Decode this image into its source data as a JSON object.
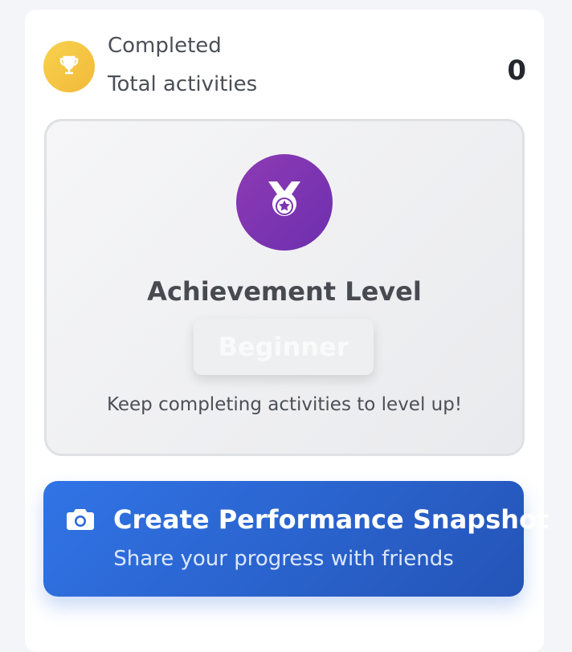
{
  "stats": {
    "label": "Completed",
    "sublabel": "Total activities",
    "value": "0",
    "icon": "trophy-icon"
  },
  "achievement": {
    "title": "Achievement Level",
    "level": "Beginner",
    "hint": "Keep completing activities to level up!",
    "icon": "medal-icon"
  },
  "snapshot": {
    "label": "Create Performance Snapshot",
    "sublabel": "Share your progress with friends",
    "icon": "camera-icon"
  },
  "colors": {
    "trophy_gradient": [
      "#f7d24c",
      "#f2b93b"
    ],
    "medal_gradient": [
      "#8e3ab4",
      "#6d2fae"
    ],
    "button_gradient": [
      "#3174e6",
      "#2454b7"
    ]
  }
}
